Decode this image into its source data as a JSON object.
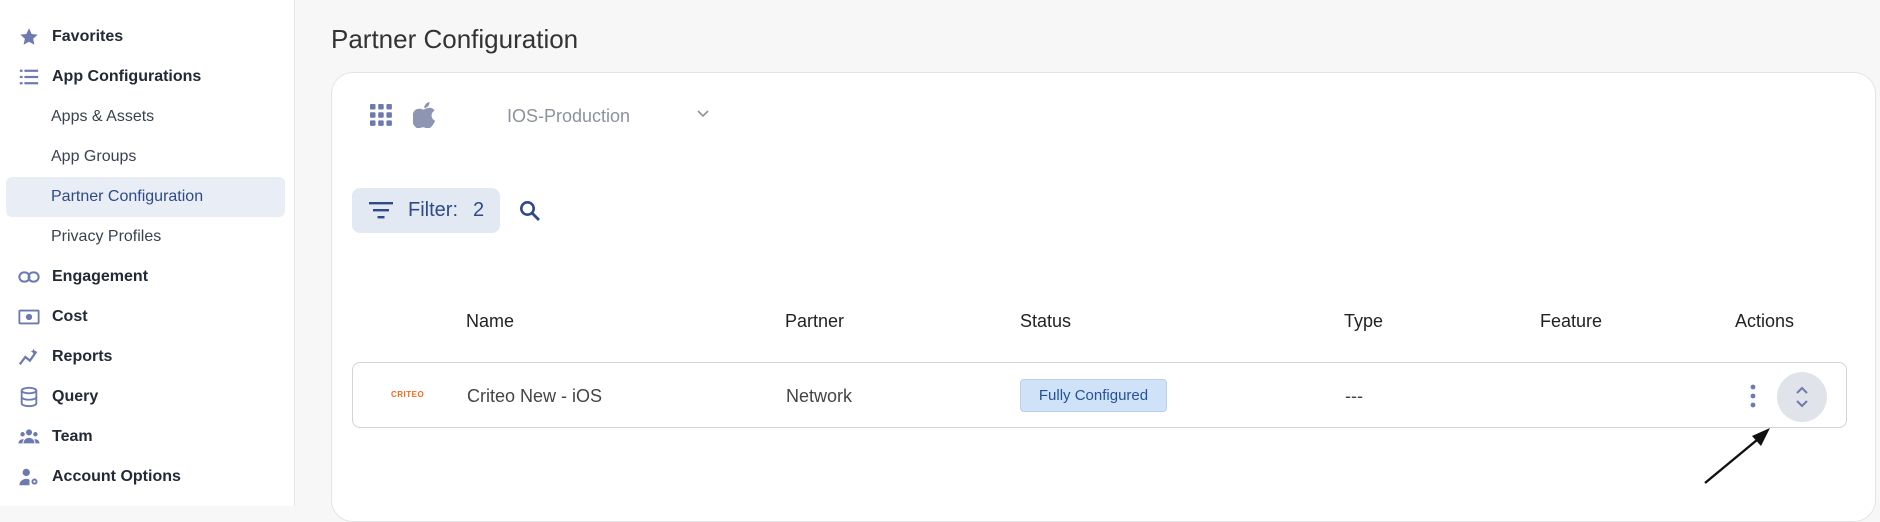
{
  "sidebar": {
    "items": [
      {
        "label": "Favorites",
        "icon": "star-icon"
      },
      {
        "label": "App Configurations",
        "icon": "list-icon"
      },
      {
        "label": "Apps & Assets"
      },
      {
        "label": "App Groups"
      },
      {
        "label": "Partner Configuration",
        "active": true
      },
      {
        "label": "Privacy Profiles"
      },
      {
        "label": "Engagement",
        "icon": "link-icon"
      },
      {
        "label": "Cost",
        "icon": "money-icon"
      },
      {
        "label": "Reports",
        "icon": "trend-icon"
      },
      {
        "label": "Query",
        "icon": "database-icon"
      },
      {
        "label": "Team",
        "icon": "team-icon"
      },
      {
        "label": "Account Options",
        "icon": "user-gear-icon"
      }
    ]
  },
  "page": {
    "title": "Partner Configuration"
  },
  "toolbar": {
    "app_select_value": "IOS-Production",
    "filter_label": "Filter:",
    "filter_count": "2"
  },
  "table": {
    "headers": {
      "name": "Name",
      "partner": "Partner",
      "status": "Status",
      "type": "Type",
      "feature": "Feature",
      "actions": "Actions"
    },
    "rows": [
      {
        "logo_text": "CRITEO",
        "name": "Criteo New - iOS",
        "partner": "Network",
        "status": "Fully Configured",
        "type": "---",
        "feature": ""
      }
    ]
  },
  "colors": {
    "accent": "#2f4a86",
    "icon": "#6c7ab0",
    "badge_bg": "#cfe2f7",
    "logo": "#f06a1d"
  }
}
